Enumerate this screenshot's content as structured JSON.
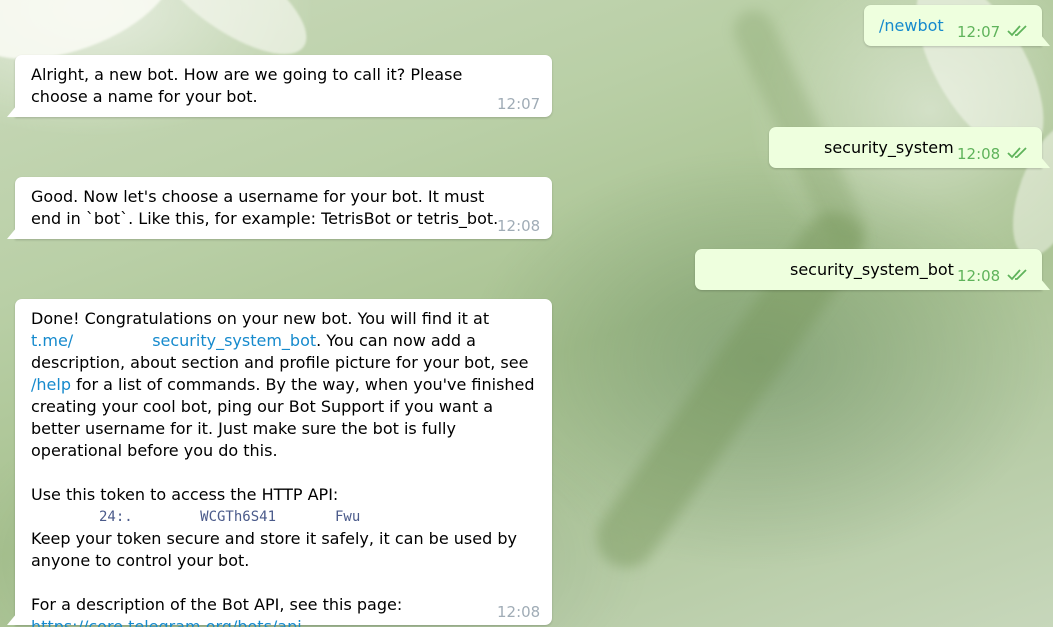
{
  "colors": {
    "incoming_bg": "#ffffff",
    "outgoing_bg": "#eeffde",
    "link": "#168acd",
    "time_incoming": "#a0acb6",
    "time_outgoing": "#5fb35b"
  },
  "messages": [
    {
      "dir": "out",
      "text": "/newbot",
      "time": "12:07",
      "status": "read"
    },
    {
      "dir": "in",
      "text": "Alright, a new bot. How are we going to call it? Please choose a name for your bot.",
      "time": "12:07"
    },
    {
      "dir": "out",
      "text": "security_system",
      "time": "12:08",
      "status": "read"
    },
    {
      "dir": "in",
      "text": "Good. Now let's choose a username for your bot. It must end in `bot`. Like this, for example: TetrisBot or tetris_bot.",
      "time": "12:08"
    },
    {
      "dir": "out",
      "text": "security_system_bot",
      "time": "12:08",
      "status": "read"
    },
    {
      "dir": "in",
      "time": "12:08",
      "intro": "Done! Congratulations on your new bot. You will find it at",
      "bot_link_prefix": "t.me/",
      "bot_link_name": "security_system_bot",
      "after_link": ". You can now add a description, about section and profile picture for your bot, see",
      "help_command": "/help",
      "after_help": "for a list of commands. By the way, when you've finished creating your cool bot, ping our Bot Support if you want a better username for it. Just make sure the bot is fully operational before you do this.",
      "token_intro": "Use this token to access the HTTP API:",
      "token_visible": "24:.        WCGTh6S41       Fwu",
      "token_warning": "Keep your token secure and store it safely, it can be used by anyone to control your bot.",
      "api_intro": "For a description of the Bot API, see this page:",
      "api_link": "https://core.telegram.org/bots/api"
    }
  ]
}
